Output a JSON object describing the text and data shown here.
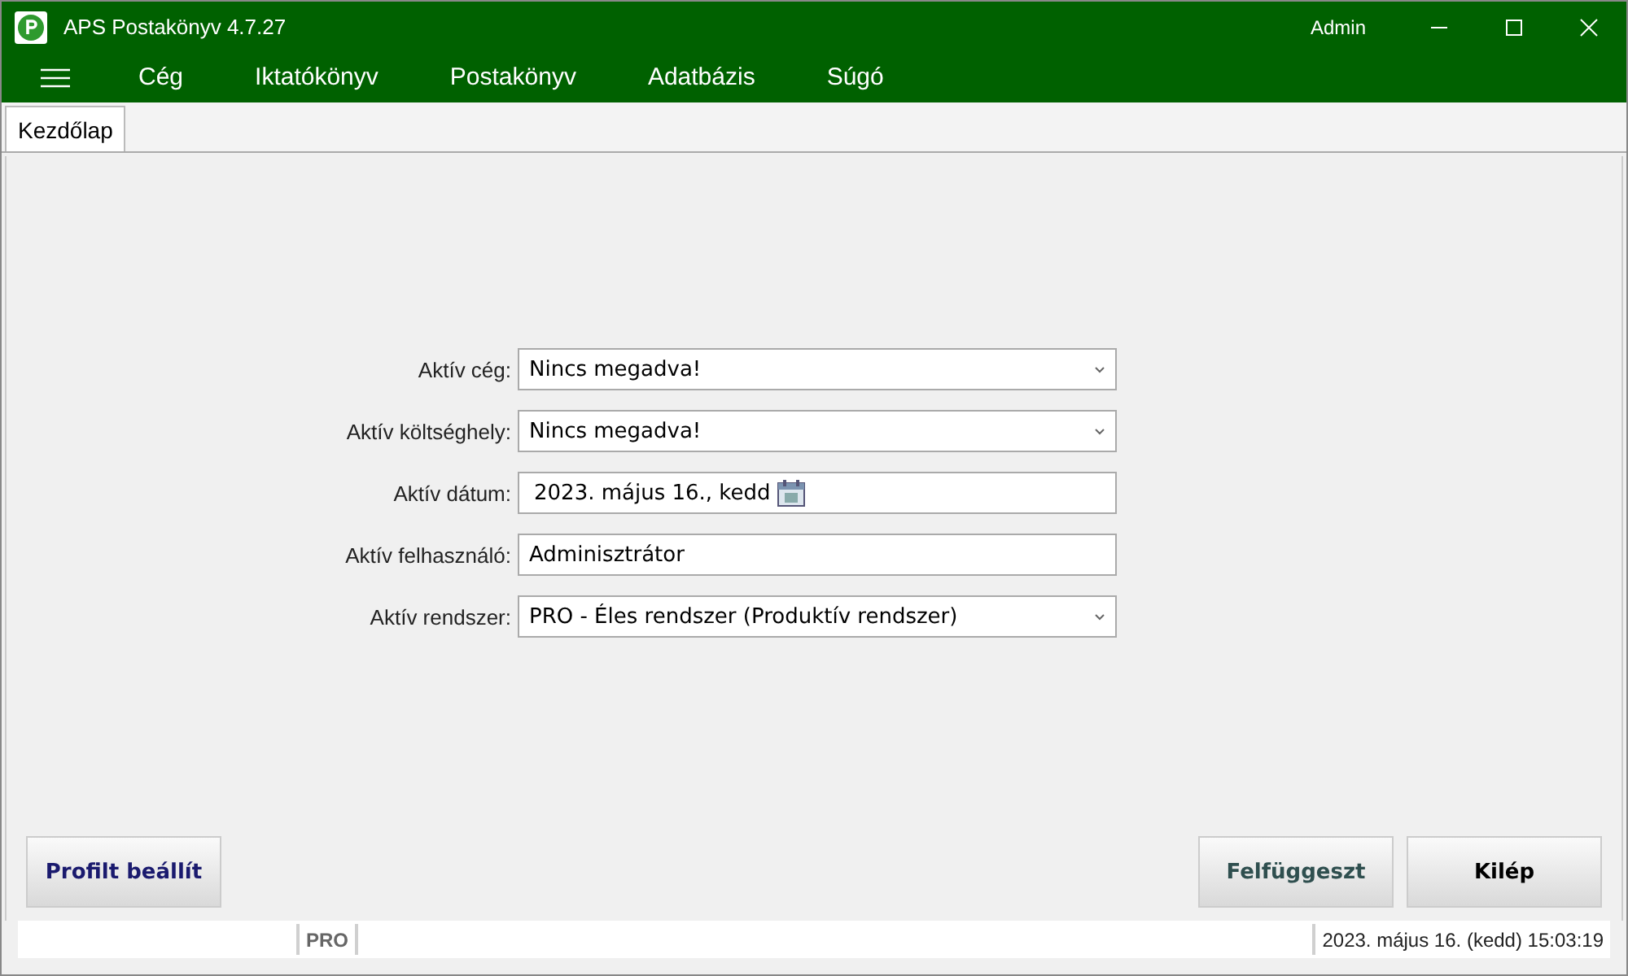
{
  "window": {
    "title": "APS Postakönyv 4.7.27",
    "user": "Admin"
  },
  "menu": [
    "Cég",
    "Iktatókönyv",
    "Postakönyv",
    "Adatbázis",
    "Súgó"
  ],
  "tabs": [
    {
      "label": "Kezdőlap",
      "selected": true
    }
  ],
  "form": [
    {
      "label": "Aktív cég:",
      "value": "Nincs megadva!",
      "kind": "combo"
    },
    {
      "label": "Aktív költséghely:",
      "value": "Nincs megadva!",
      "kind": "combo"
    },
    {
      "label": "Aktív dátum:",
      "value": "2023. május 16., kedd",
      "kind": "date"
    },
    {
      "label": "Aktív felhasználó:",
      "value": "Adminisztrátor",
      "kind": "text"
    },
    {
      "label": "Aktív rendszer:",
      "value": "PRO - Éles rendszer (Produktív rendszer)",
      "kind": "combo"
    }
  ],
  "buttons_left": [
    {
      "label": "Profilt beállít",
      "color": "#1a1a6e"
    }
  ],
  "buttons_right": [
    {
      "label": "Felfüggeszt",
      "color": "#2f4f4f"
    },
    {
      "label": "Kilép",
      "color": "#000000"
    }
  ],
  "status_bar": {
    "system": "PRO",
    "datetime": "2023. május 16. (kedd) 15:03:19"
  }
}
